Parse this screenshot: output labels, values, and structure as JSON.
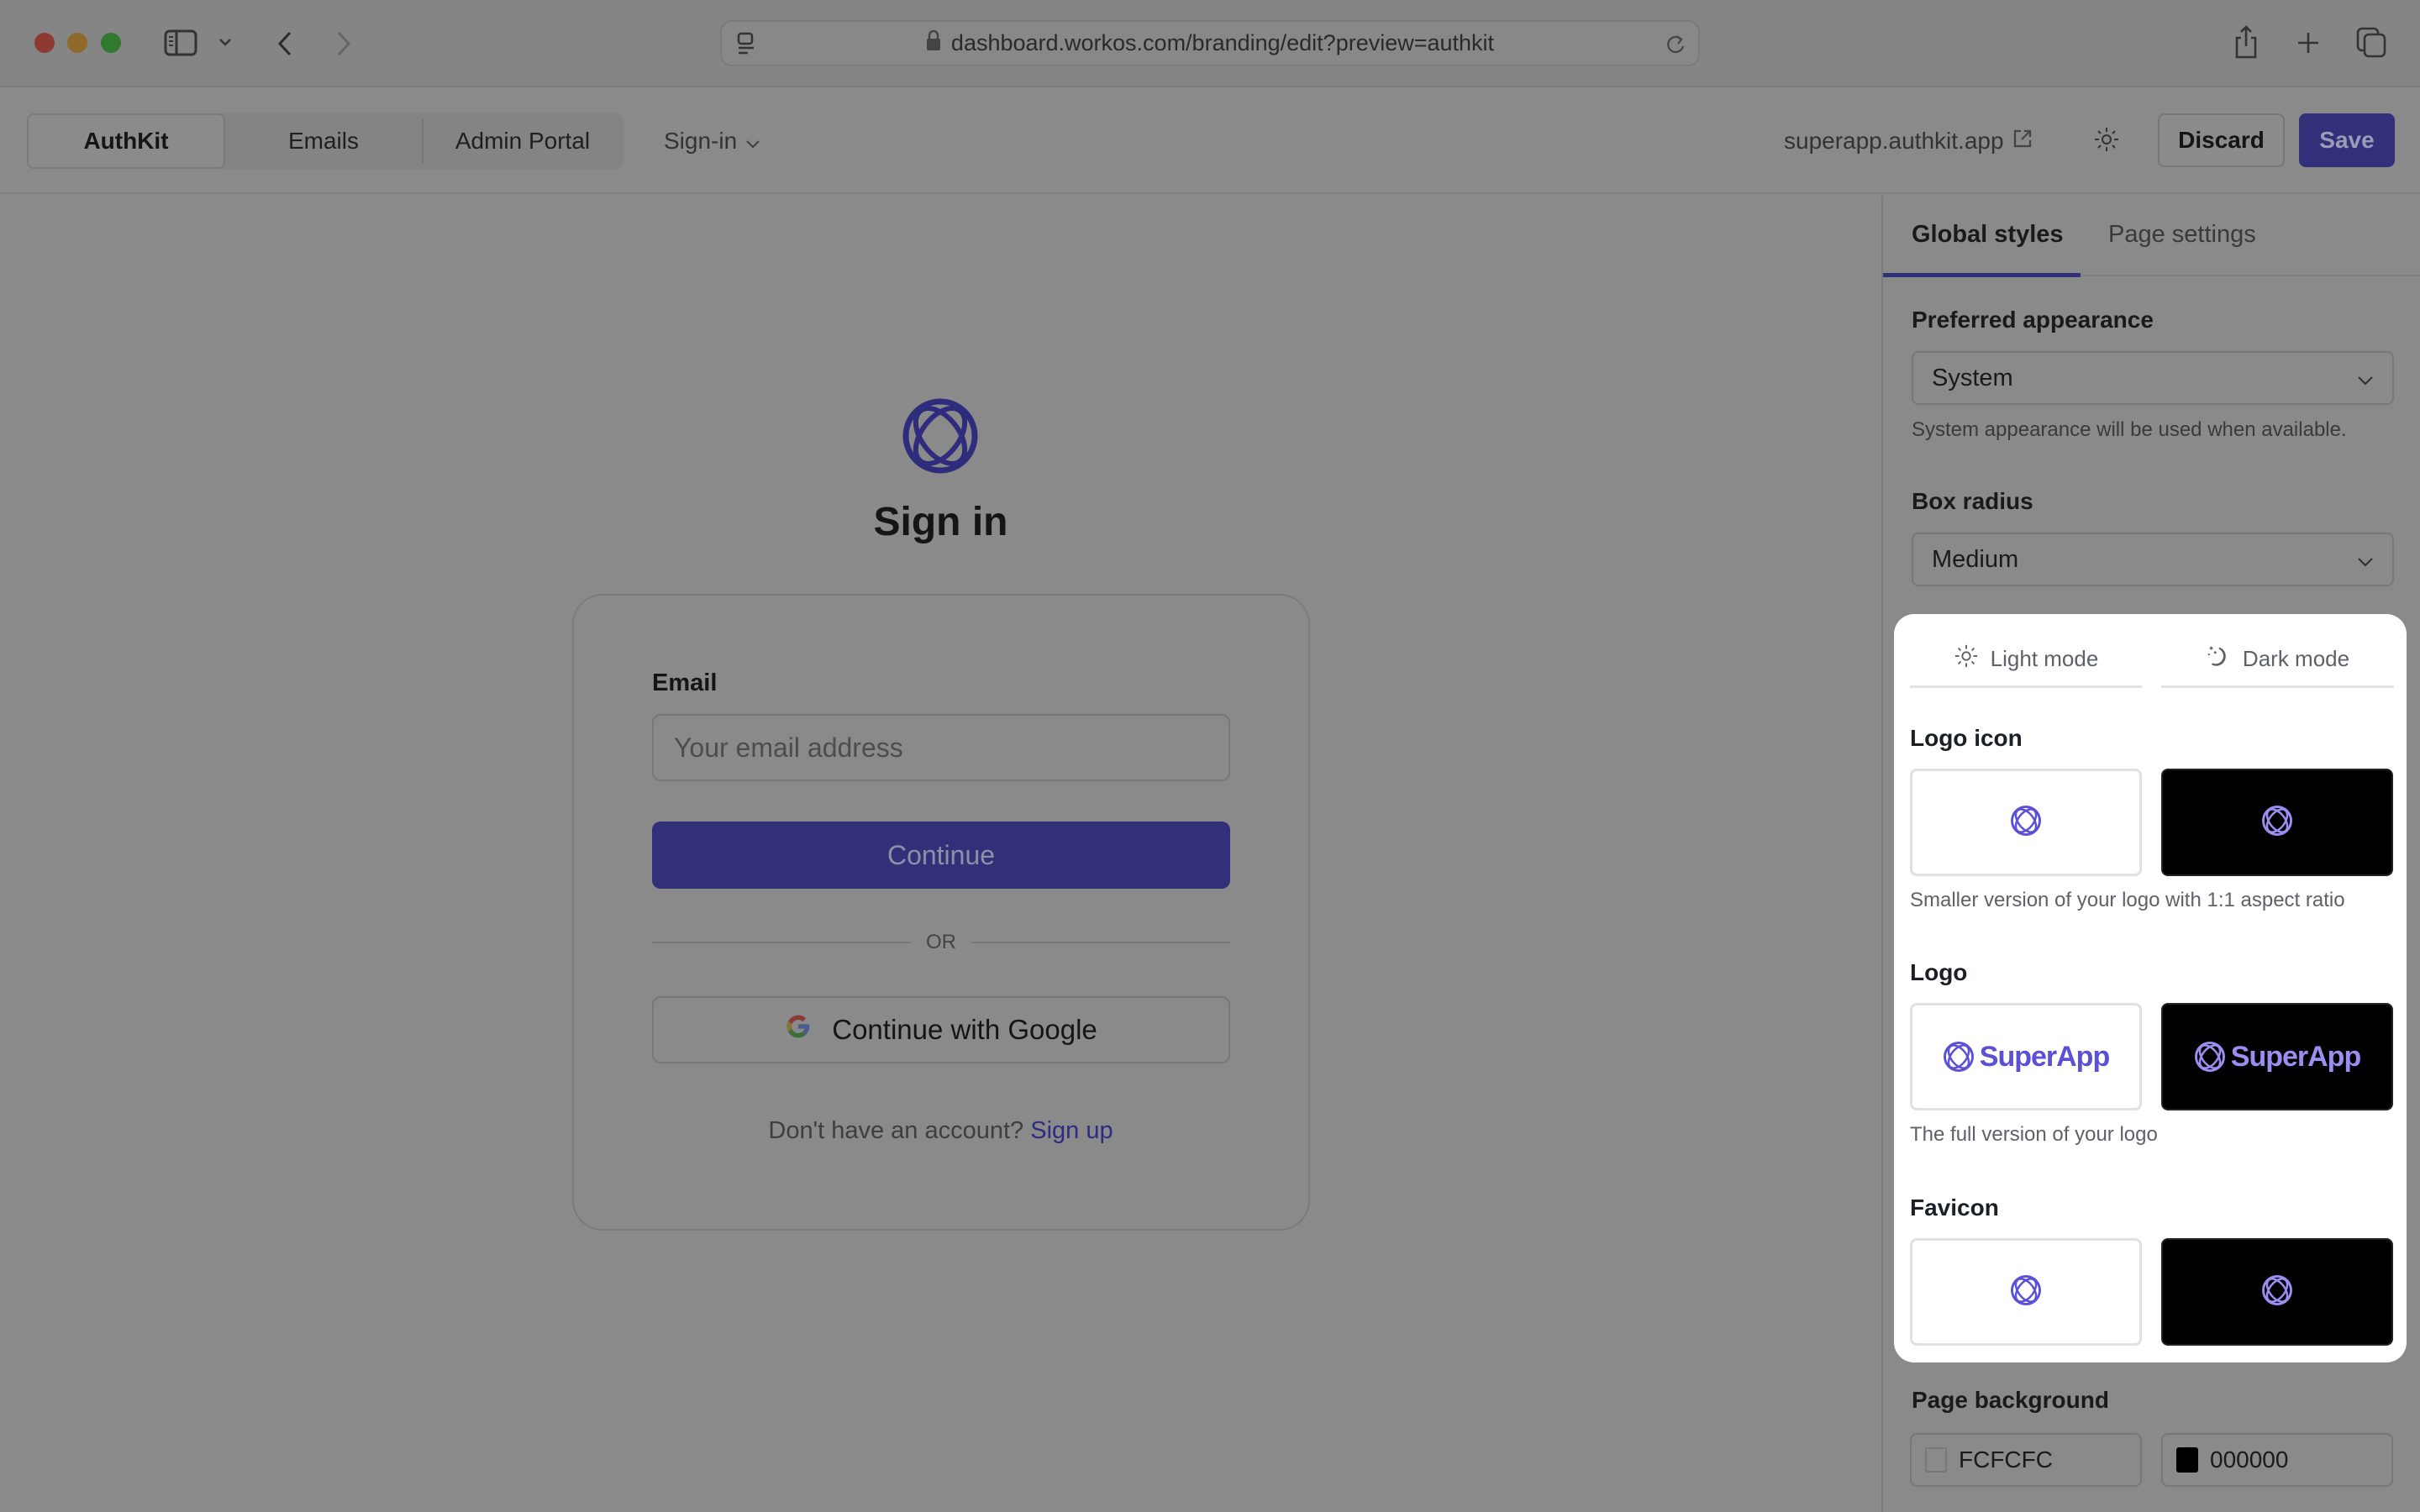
{
  "browser": {
    "url": "dashboard.workos.com/branding/edit?preview=authkit",
    "icons": [
      "sidebar-icon",
      "chevron-down-icon",
      "back-icon",
      "forward-icon",
      "reader-icon",
      "lock-icon",
      "reload-icon",
      "share-icon",
      "new-tab-icon",
      "tab-overview-icon"
    ]
  },
  "toolbar": {
    "segments": [
      {
        "label": "AuthKit",
        "active": true
      },
      {
        "label": "Emails",
        "active": false
      },
      {
        "label": "Admin Portal",
        "active": false
      }
    ],
    "page_select": "Sign-in",
    "host_link": "superapp.authkit.app",
    "discard_label": "Discard",
    "save_label": "Save"
  },
  "preview": {
    "title": "Sign in",
    "email_label": "Email",
    "email_placeholder": "Your email address",
    "email_value": "",
    "continue_label": "Continue",
    "or_label": "OR",
    "google_label": "Continue with Google",
    "signup_prompt": "Don't have an account?",
    "signup_link": "Sign up"
  },
  "panel": {
    "tabs": [
      {
        "label": "Global styles",
        "active": true
      },
      {
        "label": "Page settings",
        "active": false
      }
    ],
    "preferred_appearance": {
      "label": "Preferred appearance",
      "value": "System",
      "help": "System appearance will be used when available."
    },
    "box_radius": {
      "label": "Box radius",
      "value": "Medium"
    },
    "modes": {
      "light": "Light mode",
      "dark": "Dark mode"
    },
    "logo_icon": {
      "label": "Logo icon",
      "help": "Smaller version of your logo with 1:1 aspect ratio"
    },
    "logo": {
      "label": "Logo",
      "wordmark": "SuperApp",
      "help": "The full version of your logo"
    },
    "favicon": {
      "label": "Favicon"
    },
    "page_background": {
      "label": "Page background",
      "light": "FCFCFC",
      "dark": "000000"
    }
  },
  "colors": {
    "brand": "#5b50d6",
    "brand_dark_mode": "#9a8ff0",
    "accent_dimmed": "#33307a"
  }
}
